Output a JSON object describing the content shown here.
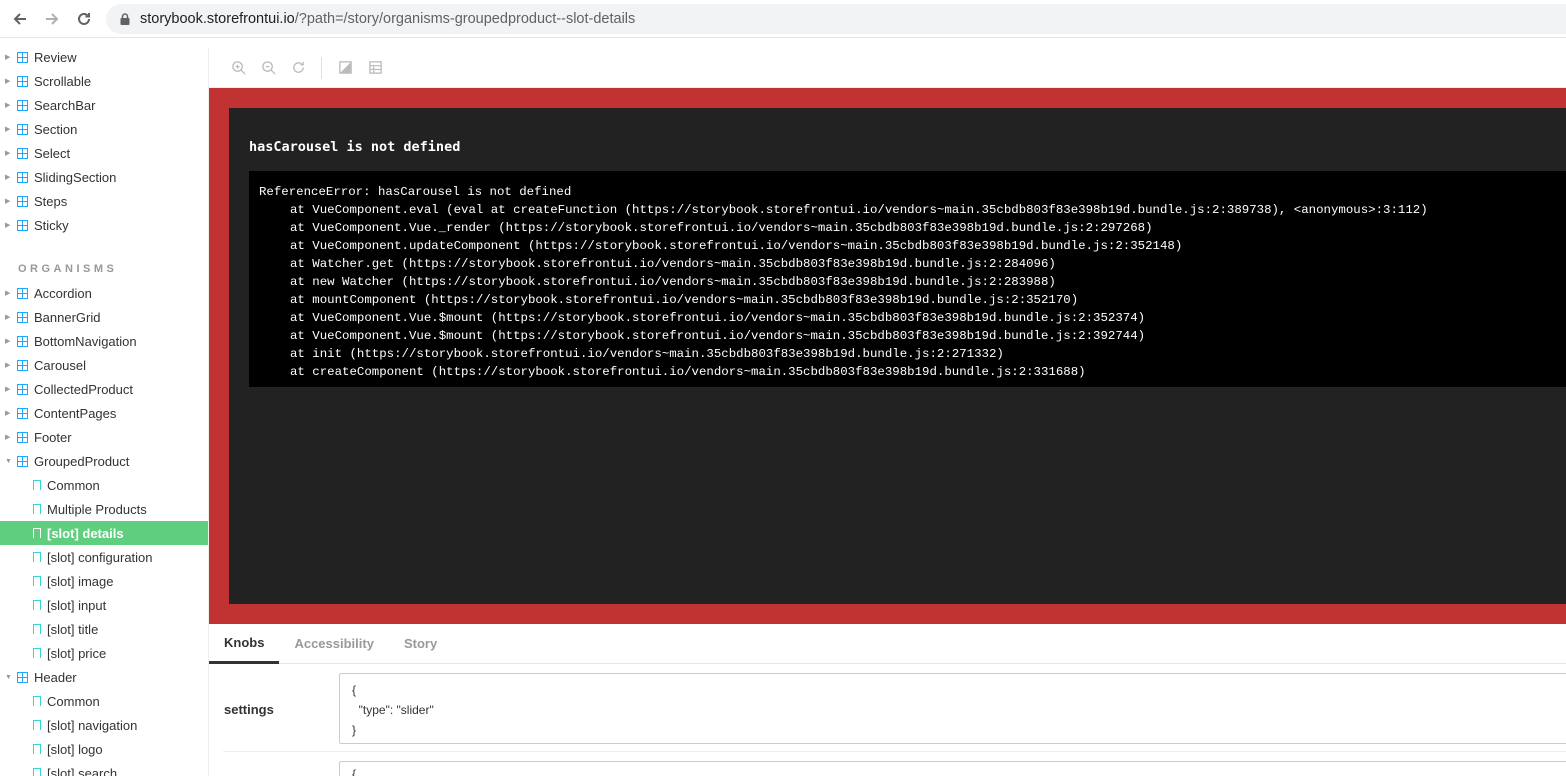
{
  "browser": {
    "url_host": "storybook.storefrontui.io",
    "url_path": "/?path=/story/organisms-groupedproduct--slot-details"
  },
  "sidebar": {
    "molecules_items": [
      {
        "label": "Review"
      },
      {
        "label": "Scrollable"
      },
      {
        "label": "SearchBar"
      },
      {
        "label": "Section"
      },
      {
        "label": "Select"
      },
      {
        "label": "SlidingSection"
      },
      {
        "label": "Steps"
      },
      {
        "label": "Sticky"
      }
    ],
    "section_heading": "ORGANISMS",
    "organisms": [
      {
        "label": "Accordion"
      },
      {
        "label": "BannerGrid"
      },
      {
        "label": "BottomNavigation"
      },
      {
        "label": "Carousel"
      },
      {
        "label": "CollectedProduct"
      },
      {
        "label": "ContentPages"
      },
      {
        "label": "Footer"
      },
      {
        "label": "GroupedProduct"
      }
    ],
    "grouped_product_stories": [
      {
        "label": "Common"
      },
      {
        "label": "Multiple Products"
      },
      {
        "label": "[slot] details"
      },
      {
        "label": "[slot] configuration"
      },
      {
        "label": "[slot] image"
      },
      {
        "label": "[slot] input"
      },
      {
        "label": "[slot] title"
      },
      {
        "label": "[slot] price"
      }
    ],
    "header_item": "Header",
    "header_stories": [
      {
        "label": "Common"
      },
      {
        "label": "[slot] navigation"
      },
      {
        "label": "[slot] logo"
      },
      {
        "label": "[slot] search"
      }
    ]
  },
  "error": {
    "title": "hasCarousel is not defined",
    "stack_first": "ReferenceError: hasCarousel is not defined",
    "stack": [
      "at VueComponent.eval (eval at createFunction (https://storybook.storefrontui.io/vendors~main.35cbdb803f83e398b19d.bundle.js:2:389738), <anonymous>:3:112)",
      "at VueComponent.Vue._render (https://storybook.storefrontui.io/vendors~main.35cbdb803f83e398b19d.bundle.js:2:297268)",
      "at VueComponent.updateComponent (https://storybook.storefrontui.io/vendors~main.35cbdb803f83e398b19d.bundle.js:2:352148)",
      "at Watcher.get (https://storybook.storefrontui.io/vendors~main.35cbdb803f83e398b19d.bundle.js:2:284096)",
      "at new Watcher (https://storybook.storefrontui.io/vendors~main.35cbdb803f83e398b19d.bundle.js:2:283988)",
      "at mountComponent (https://storybook.storefrontui.io/vendors~main.35cbdb803f83e398b19d.bundle.js:2:352170)",
      "at VueComponent.Vue.$mount (https://storybook.storefrontui.io/vendors~main.35cbdb803f83e398b19d.bundle.js:2:352374)",
      "at VueComponent.Vue.$mount (https://storybook.storefrontui.io/vendors~main.35cbdb803f83e398b19d.bundle.js:2:392744)",
      "at init (https://storybook.storefrontui.io/vendors~main.35cbdb803f83e398b19d.bundle.js:2:271332)",
      "at createComponent (https://storybook.storefrontui.io/vendors~main.35cbdb803f83e398b19d.bundle.js:2:331688)"
    ]
  },
  "addons": {
    "tabs": [
      {
        "label": "Knobs"
      },
      {
        "label": "Accessibility"
      },
      {
        "label": "Story"
      }
    ],
    "knob_label": "settings",
    "knob_value": "{\n  \"type\": \"slider\"\n}",
    "knob2_value": "{"
  }
}
